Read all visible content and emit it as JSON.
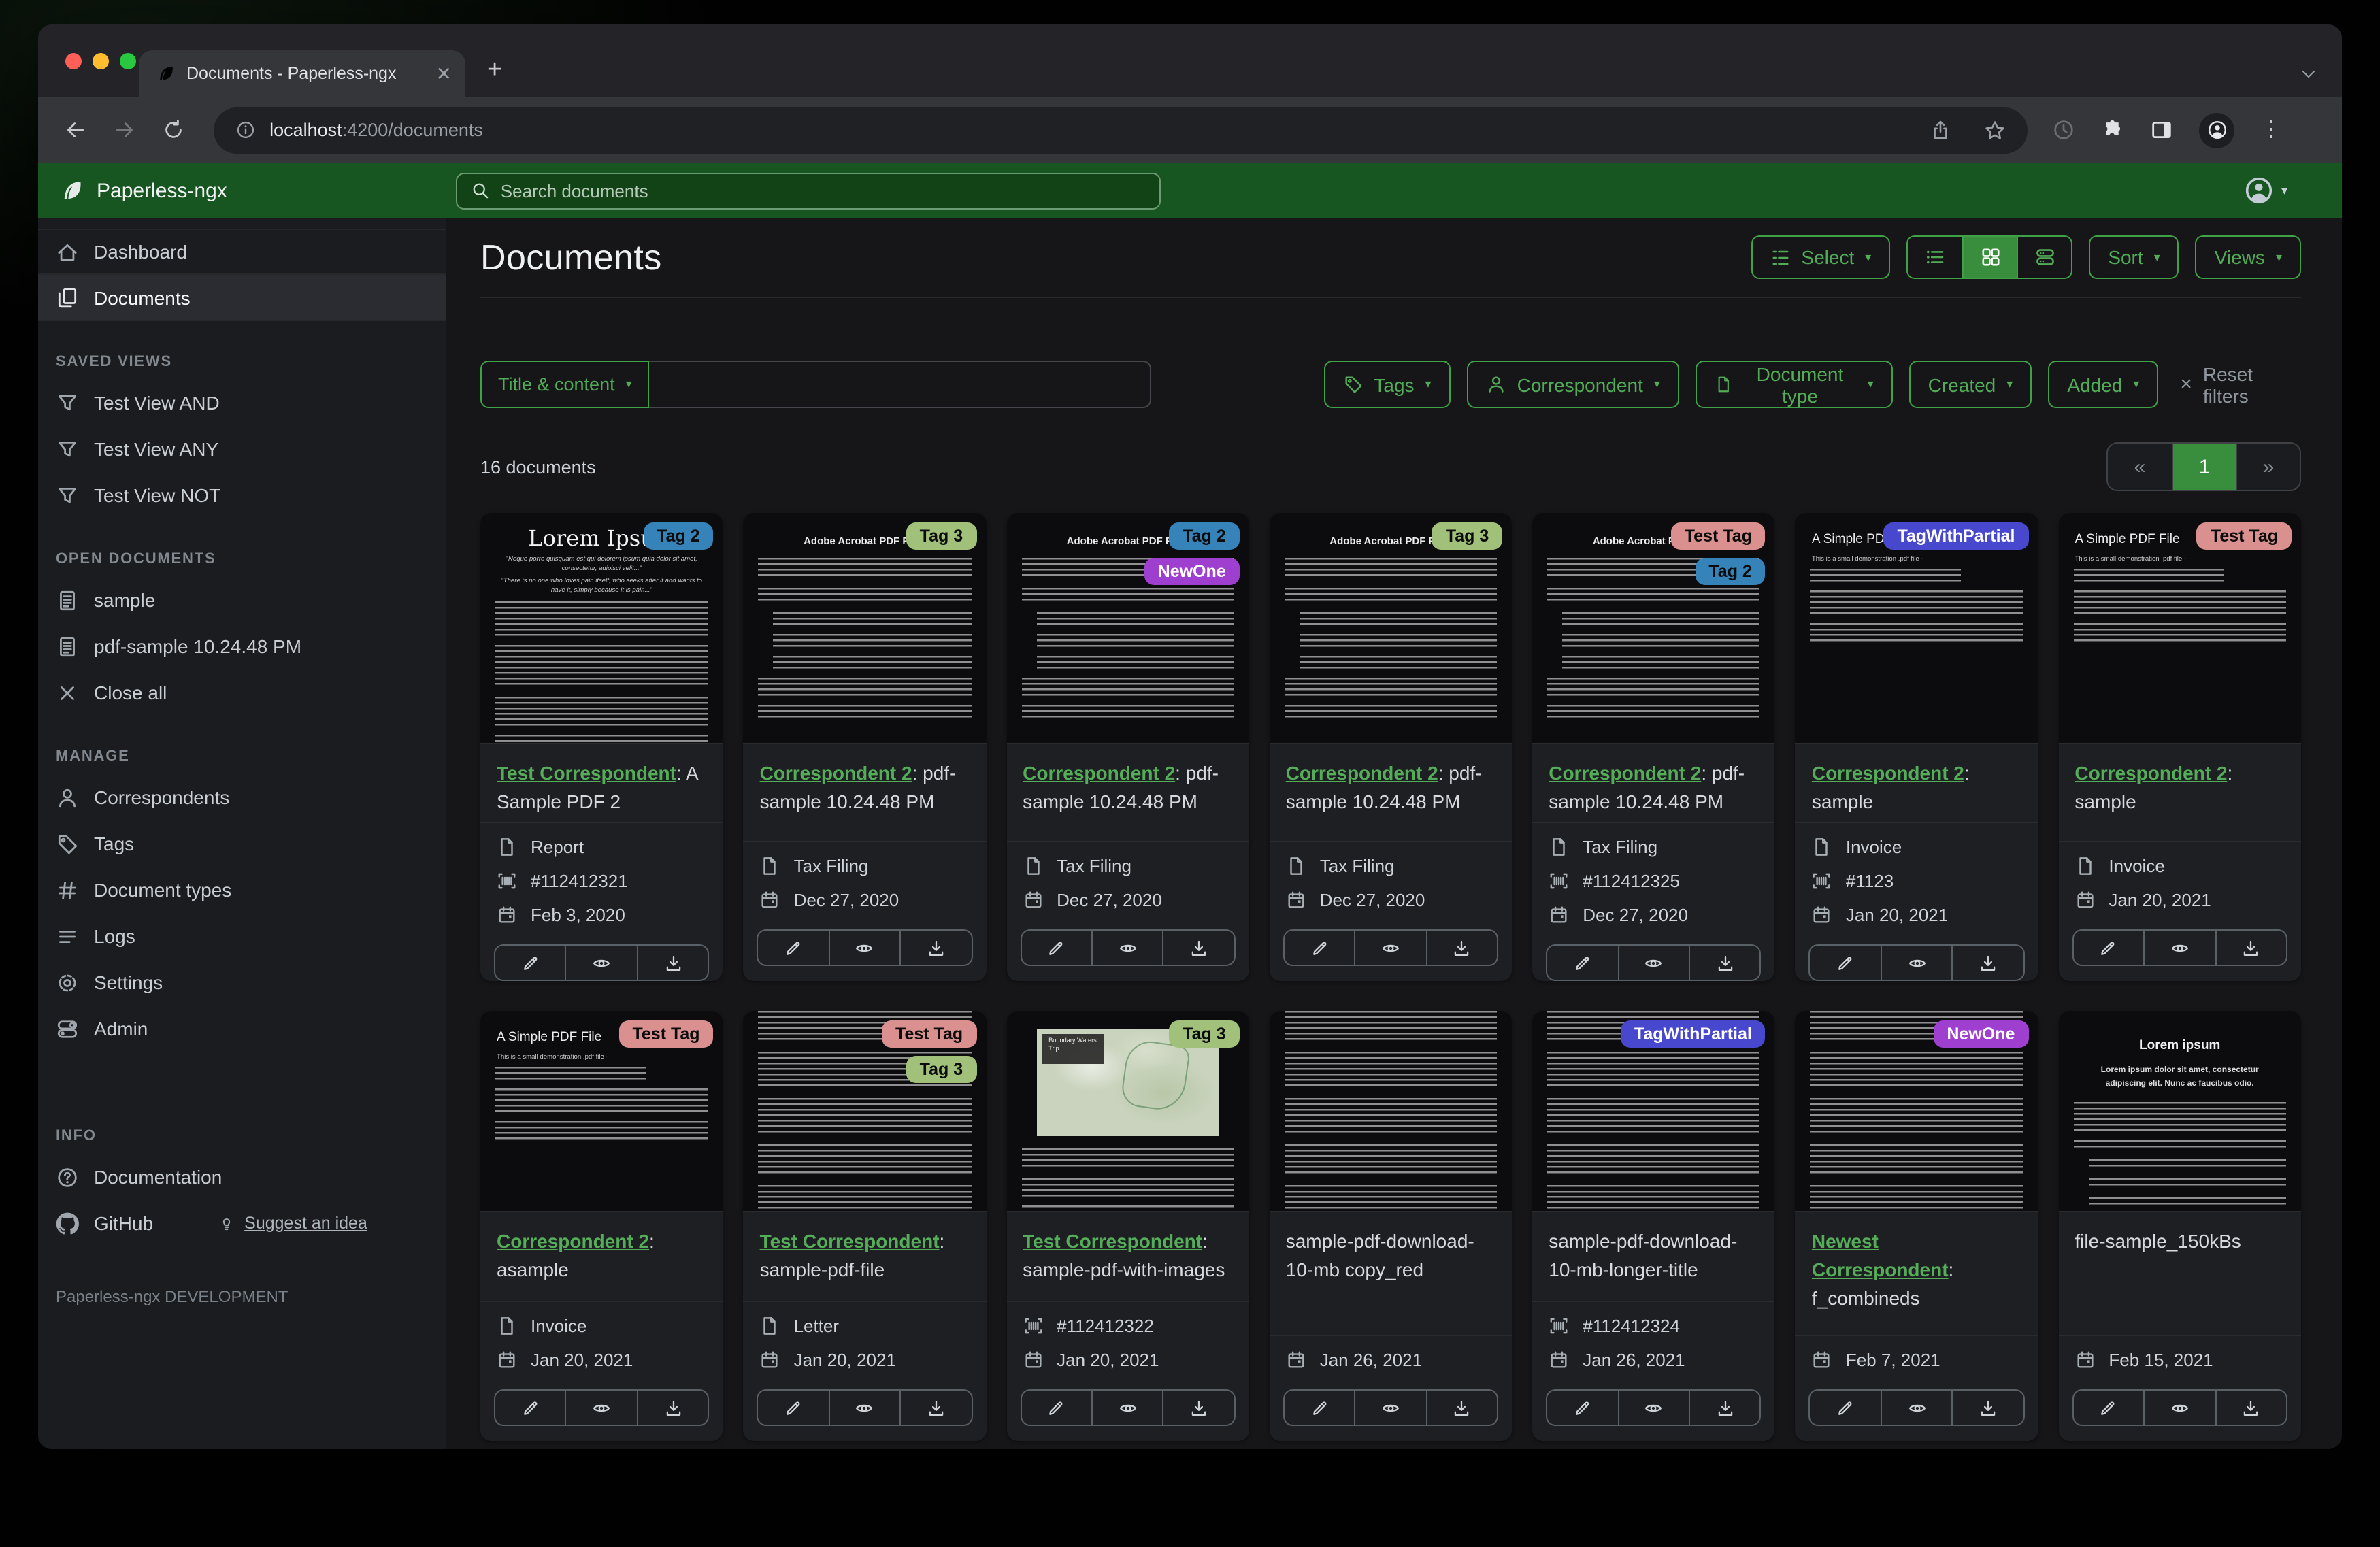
{
  "browser": {
    "tab_title": "Documents - Paperless-ngx",
    "url_host": "localhost",
    "url_rest": ":4200/documents"
  },
  "app": {
    "brand": "Paperless-ngx",
    "search_placeholder": "Search documents"
  },
  "sidebar": {
    "primary": [
      {
        "label": "Dashboard",
        "icon": "home",
        "active": false
      },
      {
        "label": "Documents",
        "icon": "copy",
        "active": true
      }
    ],
    "sections": [
      {
        "header": "SAVED VIEWS",
        "items": [
          {
            "label": "Test View AND",
            "icon": "funnel"
          },
          {
            "label": "Test View ANY",
            "icon": "funnel"
          },
          {
            "label": "Test View NOT",
            "icon": "funnel"
          }
        ]
      },
      {
        "header": "OPEN DOCUMENTS",
        "items": [
          {
            "label": "sample",
            "icon": "doc"
          },
          {
            "label": "pdf-sample 10.24.48 PM",
            "icon": "doc"
          },
          {
            "label": "Close all",
            "icon": "close"
          }
        ]
      },
      {
        "header": "MANAGE",
        "items": [
          {
            "label": "Correspondents",
            "icon": "user"
          },
          {
            "label": "Tags",
            "icon": "tag"
          },
          {
            "label": "Document types",
            "icon": "hash"
          },
          {
            "label": "Logs",
            "icon": "lines"
          },
          {
            "label": "Settings",
            "icon": "gear"
          },
          {
            "label": "Admin",
            "icon": "admin"
          }
        ]
      },
      {
        "header": "INFO",
        "extra_gap": true,
        "items": [
          {
            "label": "Documentation",
            "icon": "question"
          },
          {
            "label": "GitHub",
            "icon": "github",
            "extra": {
              "label": "Suggest an idea",
              "icon": "bulb"
            }
          }
        ]
      }
    ],
    "footer": "Paperless-ngx DEVELOPMENT"
  },
  "page": {
    "title": "Documents",
    "actions": {
      "select": "Select",
      "sort": "Sort",
      "views": "Views"
    }
  },
  "filters": {
    "field": "Title & content",
    "query": "",
    "buttons": [
      {
        "label": "Tags",
        "icon": "tag"
      },
      {
        "label": "Correspondent",
        "icon": "user"
      },
      {
        "label": "Document type",
        "icon": "file"
      },
      {
        "label": "Created",
        "icon": null
      },
      {
        "label": "Added",
        "icon": null
      }
    ],
    "reset": "Reset filters"
  },
  "results": {
    "count": "16 documents",
    "pager": {
      "prev": "«",
      "page": "1",
      "next": "»"
    }
  },
  "tag_colors": {
    "Tag 2": {
      "bg": "#3583b8",
      "fg": "#0b0b0b"
    },
    "Tag 3": {
      "bg": "#a1c17a",
      "fg": "#0b0b0b"
    },
    "NewOne": {
      "bg": "#9e3fd0",
      "fg": "#ffffff"
    },
    "Test Tag": {
      "bg": "#d9908f",
      "fg": "#0b0b0b"
    },
    "TagWithPartial": {
      "bg": "#4848cf",
      "fg": "#ffffff"
    }
  },
  "documents": {
    "cards": [
      {
        "tags": [
          "Tag 2"
        ],
        "thumb": {
          "variant": "lorem-serif",
          "title": "Lorem Ipsum",
          "subtitles": [
            "“Neque porro quisquam est qui dolorem ipsum quia dolor sit amet, consectetur, adipisci velit...”",
            "“There is no one who loves pain itself, who seeks after it and wants to have it, simply because it is pain...”"
          ]
        },
        "correspondent": "Test Correspondent",
        "title": "A Sample PDF 2",
        "type": "Report",
        "asn": "#112412321",
        "date": "Feb 3, 2020"
      },
      {
        "tags": [
          "Tag 3"
        ],
        "thumb": {
          "variant": "adobe",
          "title": "Adobe Acrobat PDF Files"
        },
        "correspondent": "Correspondent 2",
        "title": "pdf-sample 10.24.48 PM",
        "type": "Tax Filing",
        "asn": null,
        "date": "Dec 27, 2020"
      },
      {
        "tags": [
          "Tag 2",
          "NewOne"
        ],
        "thumb": {
          "variant": "adobe",
          "title": "Adobe Acrobat PDF Files"
        },
        "correspondent": "Correspondent 2",
        "title": "pdf-sample 10.24.48 PM",
        "type": "Tax Filing",
        "asn": null,
        "date": "Dec 27, 2020"
      },
      {
        "tags": [
          "Tag 3"
        ],
        "thumb": {
          "variant": "adobe",
          "title": "Adobe Acrobat PDF Files"
        },
        "correspondent": "Correspondent 2",
        "title": "pdf-sample 10.24.48 PM",
        "type": "Tax Filing",
        "asn": null,
        "date": "Dec 27, 2020"
      },
      {
        "tags": [
          "Test Tag",
          "Tag 2"
        ],
        "thumb": {
          "variant": "adobe",
          "title": "Adobe Acrobat PDF Files"
        },
        "correspondent": "Correspondent 2",
        "title": "pdf-sample 10.24.48 PM",
        "type": "Tax Filing",
        "asn": "#112412325",
        "date": "Dec 27, 2020"
      },
      {
        "tags": [
          "TagWithPartial"
        ],
        "thumb": {
          "variant": "simple",
          "title": "A Simple PDF File",
          "subtitles": [
            "This is a small demonstration .pdf file -"
          ]
        },
        "correspondent": "Correspondent 2",
        "title": "sample",
        "type": "Invoice",
        "asn": "#1123",
        "date": "Jan 20, 2021"
      },
      {
        "tags": [
          "Test Tag"
        ],
        "thumb": {
          "variant": "simple",
          "title": "A Simple PDF File",
          "subtitles": [
            "This is a small demonstration .pdf file -"
          ]
        },
        "correspondent": "Correspondent 2",
        "title": "sample",
        "type": "Invoice",
        "asn": null,
        "date": "Jan 20, 2021"
      },
      {
        "tags": [
          "Test Tag"
        ],
        "thumb": {
          "variant": "simple",
          "title": "A Simple PDF File",
          "subtitles": [
            "This is a small demonstration .pdf file -"
          ]
        },
        "correspondent": "Correspondent 2",
        "title": "asample",
        "type": "Invoice",
        "asn": null,
        "date": "Jan 20, 2021"
      },
      {
        "tags": [
          "Test Tag",
          "Tag 3"
        ],
        "thumb": {
          "variant": "dense",
          "title": ""
        },
        "correspondent": "Test Correspondent",
        "title": "sample-pdf-file",
        "type": "Letter",
        "asn": null,
        "date": "Jan 20, 2021"
      },
      {
        "tags": [
          "Tag 3"
        ],
        "thumb": {
          "variant": "map",
          "title": "Boundary Waters Trip"
        },
        "correspondent": "Test Correspondent",
        "title": "sample-pdf-with-images",
        "type": null,
        "asn": "#112412322",
        "date": "Jan 20, 2021"
      },
      {
        "tags": [],
        "thumb": {
          "variant": "dense",
          "title": ""
        },
        "correspondent": null,
        "title": "sample-pdf-download-10-mb copy_red",
        "type": null,
        "asn": null,
        "date": "Jan 26, 2021"
      },
      {
        "tags": [
          "TagWithPartial"
        ],
        "thumb": {
          "variant": "dense",
          "title": ""
        },
        "correspondent": null,
        "title": "sample-pdf-download-10-mb-longer-title",
        "type": null,
        "asn": "#112412324",
        "date": "Jan 26, 2021"
      },
      {
        "tags": [
          "NewOne"
        ],
        "thumb": {
          "variant": "dense",
          "title": ""
        },
        "correspondent": "Newest Correspondent",
        "title": "f_combineds",
        "type": null,
        "asn": null,
        "date": "Feb 7, 2021"
      },
      {
        "tags": [],
        "thumb": {
          "variant": "lorem-sans",
          "title": "Lorem ipsum",
          "subtitles": [
            "Lorem ipsum dolor sit amet, consectetur adipiscing elit. Nunc ac faucibus odio."
          ]
        },
        "correspondent": null,
        "title": "file-sample_150kBs",
        "type": null,
        "asn": null,
        "date": "Feb 15, 2021"
      }
    ]
  }
}
